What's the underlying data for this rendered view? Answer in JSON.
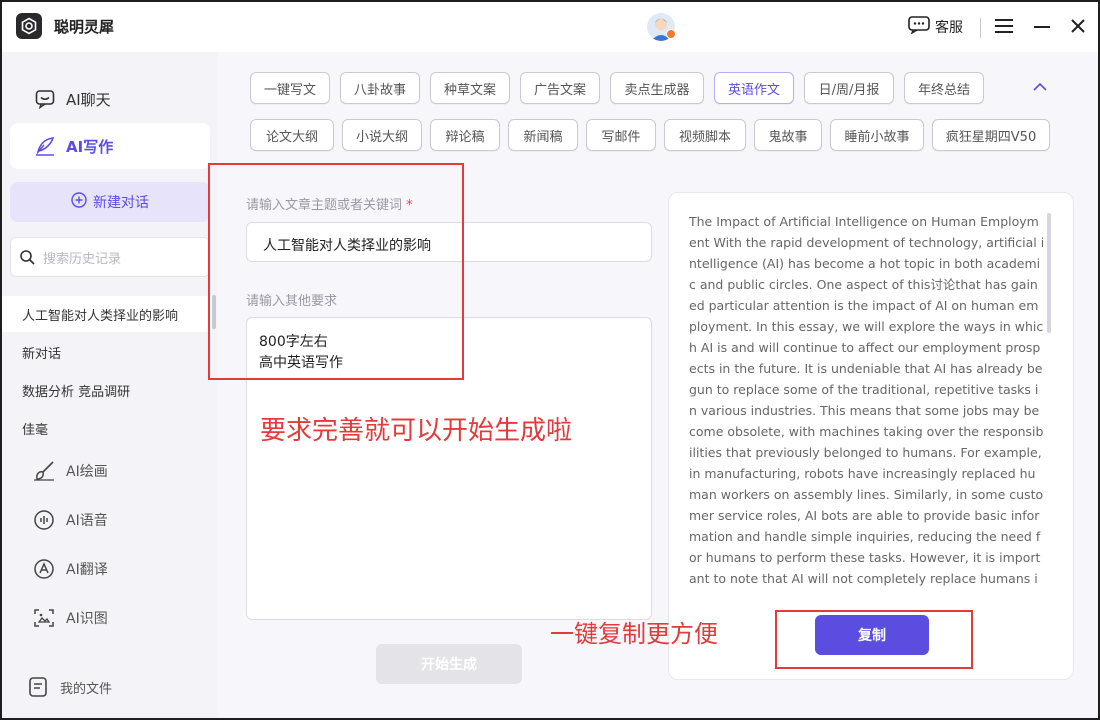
{
  "app": {
    "name": "聪明灵犀"
  },
  "titlebar": {
    "support_label": "客服"
  },
  "sidebar": {
    "nav": [
      {
        "label": "AI聊天",
        "icon": "chat-bubble-icon"
      },
      {
        "label": "AI写作",
        "icon": "pen-icon"
      }
    ],
    "new_chat_label": "新建对话",
    "search_placeholder": "搜索历史记录",
    "history": [
      "人工智能对人类择业的影响",
      "新对话",
      "数据分析 竞品调研",
      "佳毫"
    ],
    "tools": [
      {
        "label": "AI绘画",
        "icon": "brush-icon"
      },
      {
        "label": "AI语音",
        "icon": "voice-icon"
      },
      {
        "label": "AI翻译",
        "icon": "translate-icon"
      },
      {
        "label": "AI识图",
        "icon": "image-scan-icon"
      }
    ],
    "my_files_label": "我的文件"
  },
  "tags": {
    "row1": [
      "一键写文",
      "八卦故事",
      "种草文案",
      "广告文案",
      "卖点生成器",
      "英语作文",
      "日/周/月报",
      "年终总结"
    ],
    "row2": [
      "论文大纲",
      "小说大纲",
      "辩论稿",
      "新闻稿",
      "写邮件",
      "视频脚本",
      "鬼故事",
      "睡前小故事",
      "疯狂星期四V50"
    ],
    "active": "英语作文"
  },
  "form": {
    "topic_label": "请输入文章主题或者关键词",
    "required_mark": "*",
    "topic_value": "人工智能对人类择业的影响",
    "other_label": "请输入其他要求",
    "other_line1": "800字左右",
    "other_line2": "高中英语写作",
    "generate_label": "开始生成"
  },
  "result": {
    "text": "The Impact of Artificial Intelligence on Human Employment With the rapid development of technology, artificial intelligence (AI) has become a hot topic in both academic and public circles. One aspect of this讨论that has gained particular attention is the impact of AI on human employment. In this essay, we will explore the ways in which AI is and will continue to affect our employment prospects in the future. It is undeniable that AI has already begun to replace some of the traditional, repetitive tasks in various industries. This means that some jobs may become obsolete, with machines taking over the responsibilities that previously belonged to humans. For example, in manufacturing, robots have increasingly replaced human workers on assembly lines. Similarly, in some customer service roles, AI bots are able to provide basic information and handle simple inquiries, reducing the need for humans to perform these tasks. However, it is important to note that AI will not completely replace humans in all jobs. Many tasks require",
    "copy_label": "复制"
  },
  "annotations": {
    "complete_text": "要求完善就可以开始生成啦",
    "copy_text": "一键复制更方便"
  },
  "colors": {
    "accent": "#5b4de0",
    "annotation": "#e23b3b"
  }
}
